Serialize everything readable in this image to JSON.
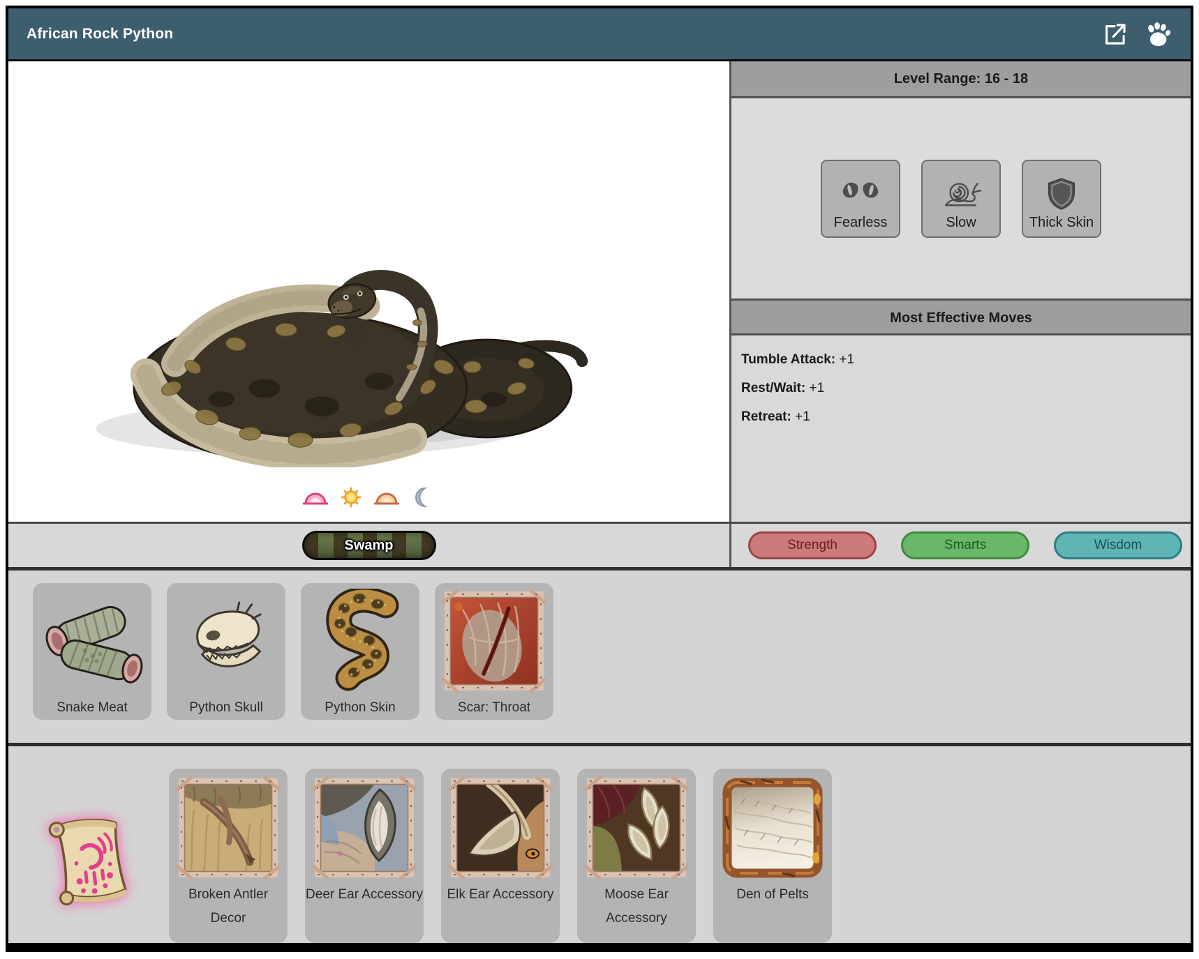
{
  "window": {
    "title": "African Rock Python",
    "icons": [
      "external-link-icon",
      "paw-icon"
    ]
  },
  "creature": {
    "name": "African Rock Python",
    "biome": "Swamp",
    "active_times": [
      "dawn",
      "day",
      "dusk",
      "night"
    ]
  },
  "right_panel": {
    "level_range": "Level Range: 16 - 18",
    "traits": [
      {
        "label": "Fearless",
        "icon": "cat-eyes-icon"
      },
      {
        "label": "Slow",
        "icon": "snail-icon"
      },
      {
        "label": "Thick Skin",
        "icon": "shield-icon"
      }
    ],
    "moves_header": "Most Effective Moves",
    "moves": [
      {
        "name": "Tumble Attack:",
        "value": "+1"
      },
      {
        "name": "Rest/Wait:",
        "value": "+1"
      },
      {
        "name": "Retreat:",
        "value": "+1"
      }
    ],
    "stats": [
      {
        "label": "Strength",
        "fill": "#cd7a7a",
        "border": "#9a4343",
        "text": "#6a2020"
      },
      {
        "label": "Smarts",
        "fill": "#6bb769",
        "border": "#3d8c3d",
        "text": "#1e5c1e"
      },
      {
        "label": "Wisdom",
        "fill": "#5fb4b6",
        "border": "#2e7d85",
        "text": "#14545c"
      }
    ]
  },
  "drops": [
    {
      "label": "Snake Meat"
    },
    {
      "label": "Python Skull"
    },
    {
      "label": "Python Skin"
    },
    {
      "label": "Scar: Throat"
    }
  ],
  "craftables": {
    "recipe_icon": "glowing-scroll-icon",
    "items": [
      {
        "label": "Broken Antler Decor"
      },
      {
        "label": "Deer Ear Accessory"
      },
      {
        "label": "Elk Ear Accessory"
      },
      {
        "label": "Moose Ear Accessory"
      },
      {
        "label": "Den of Pelts"
      }
    ]
  },
  "colors": {
    "titlebar": "#3d5e6e",
    "section_header": "#9e9e9e",
    "panel_bg": "#dcdcdc",
    "card_bg": "#b4b4b4",
    "strength": "#cd7a7a",
    "smarts": "#6bb769",
    "wisdom": "#5fb4b6"
  }
}
